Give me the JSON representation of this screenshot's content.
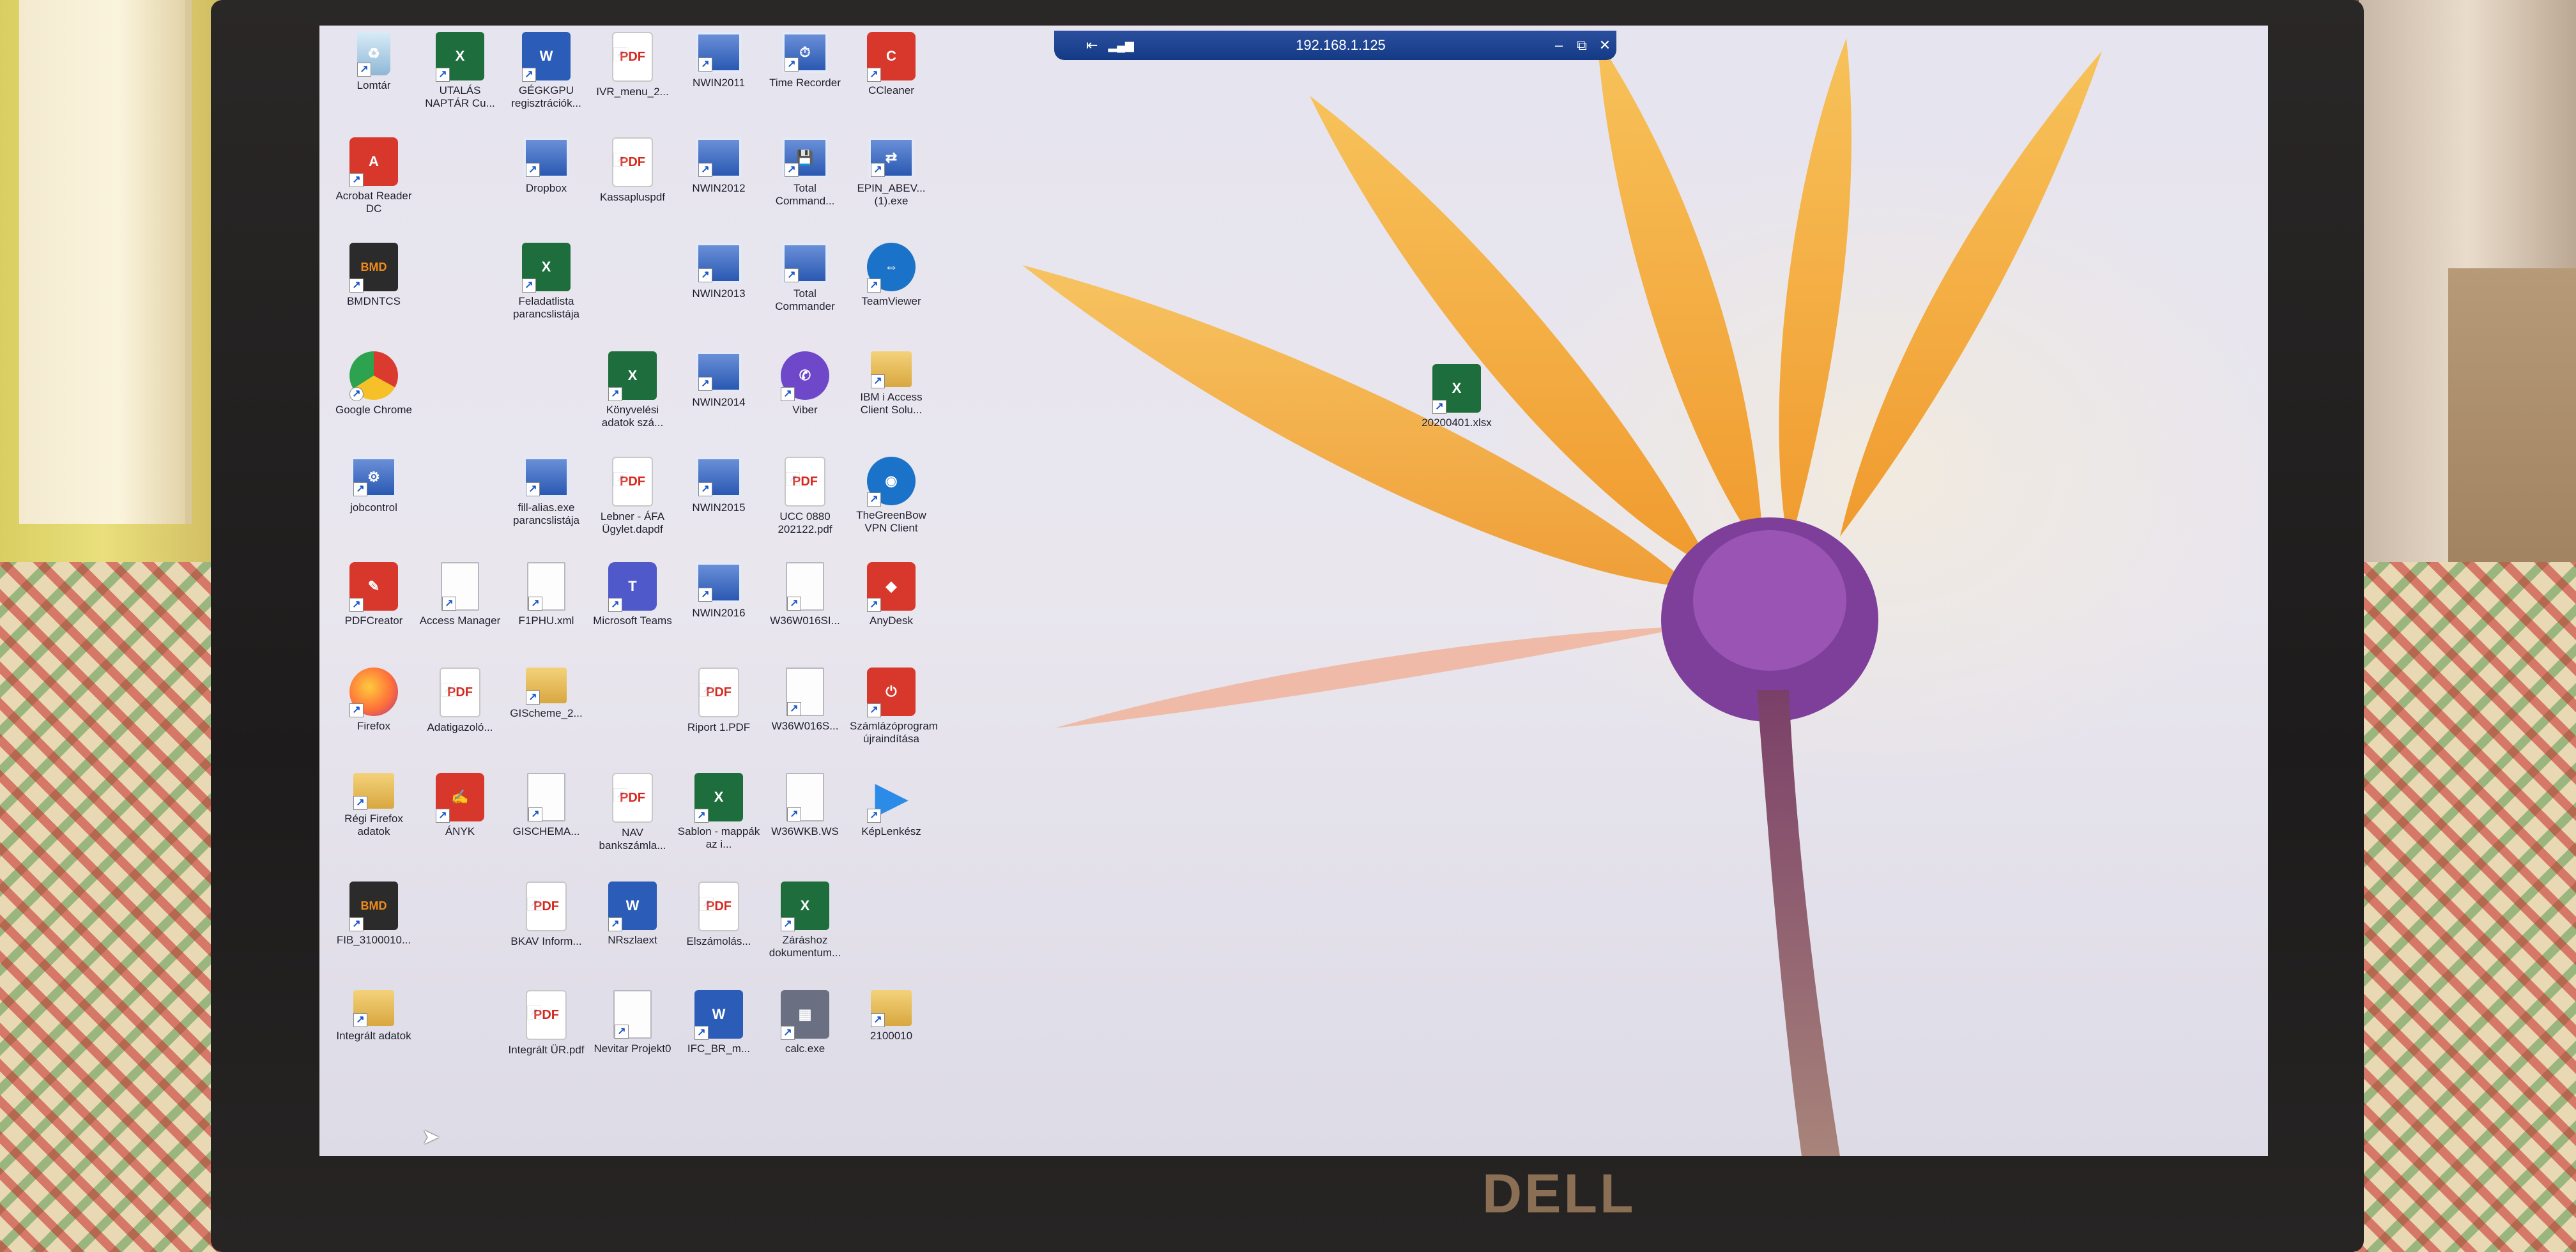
{
  "remote_session": {
    "host": "192.168.1.125",
    "pin_glyph": "⇤",
    "signal_glyph": "▂▄▆",
    "minimize_glyph": "–",
    "restore_glyph": "⧉",
    "close_glyph": "✕"
  },
  "laptop": {
    "brand": "DELL"
  },
  "desktop": {
    "icons": [
      {
        "label": "Lomtár",
        "type": "recycle-bin-icon",
        "glyph": "♻"
      },
      {
        "label": "UTALÁS NAPTÁR Cu...",
        "type": "excel-icon",
        "glyph": "X"
      },
      {
        "label": "GÉGKGPU regisztrációk...",
        "type": "word-icon",
        "glyph": "W"
      },
      {
        "label": "IVR_menu_2...",
        "type": "pdf-icon",
        "glyph": "PDF"
      },
      {
        "label": "NWIN2011",
        "type": "app-icon",
        "glyph": ""
      },
      {
        "label": "Time Recorder",
        "type": "app-icon",
        "glyph": "⏱"
      },
      {
        "label": "CCleaner",
        "type": "ccleaner-icon",
        "glyph": "C"
      },
      {
        "label": "Acrobat Reader DC",
        "type": "acrobat-icon",
        "glyph": "A"
      },
      {
        "label": "Dropbox",
        "type": "app-icon",
        "glyph": ""
      },
      {
        "label": "Kassapluspdf",
        "type": "pdf-icon",
        "glyph": "PDF"
      },
      {
        "label": "NWIN2012",
        "type": "app-icon",
        "glyph": ""
      },
      {
        "label": "Total Command...",
        "type": "floppy-icon",
        "glyph": "💾"
      },
      {
        "label": "EPIN_ABEV... (1).exe",
        "type": "app-icon",
        "glyph": "⇄"
      },
      {
        "label": "BMDNTCS",
        "type": "bmd-icon",
        "glyph": "BMD"
      },
      {
        "label": "Feladatlista parancslistája",
        "type": "excel-icon",
        "glyph": "X"
      },
      {
        "label": "NWIN2013",
        "type": "app-icon",
        "glyph": ""
      },
      {
        "label": "Total Commander",
        "type": "app-icon",
        "glyph": ""
      },
      {
        "label": "TeamViewer",
        "type": "teamviewer-icon",
        "glyph": "⇔"
      },
      {
        "label": "Google Chrome",
        "type": "chrome-icon",
        "glyph": ""
      },
      {
        "label": "Könyvelési adatok szá...",
        "type": "excel-icon",
        "glyph": "X"
      },
      {
        "label": "NWIN2014",
        "type": "app-icon",
        "glyph": ""
      },
      {
        "label": "Viber",
        "type": "viber-icon",
        "glyph": "✆"
      },
      {
        "label": "IBM i Access Client Solu...",
        "type": "folder-icon",
        "glyph": ""
      },
      {
        "label": "jobcontrol",
        "type": "setup-icon",
        "glyph": "⚙"
      },
      {
        "label": "fill-alias.exe parancslistája",
        "type": "app-icon",
        "glyph": ""
      },
      {
        "label": "Lebner - ÁFA Ügylet.dapdf",
        "type": "pdf-icon",
        "glyph": "PDF"
      },
      {
        "label": "NWIN2015",
        "type": "app-icon",
        "glyph": ""
      },
      {
        "label": "UCC 0880 202122.pdf",
        "type": "pdf-icon",
        "glyph": "PDF"
      },
      {
        "label": "TheGreenBow VPN Client",
        "type": "vpn-icon",
        "glyph": "◉"
      },
      {
        "label": "PDFCreator",
        "type": "pdfcreator-icon",
        "glyph": "✎"
      },
      {
        "label": "Access Manager",
        "type": "document-icon",
        "glyph": ""
      },
      {
        "label": "F1PHU.xml",
        "type": "document-icon",
        "glyph": ""
      },
      {
        "label": "Microsoft Teams",
        "type": "teams-icon",
        "glyph": "T"
      },
      {
        "label": "NWIN2016",
        "type": "app-icon",
        "glyph": ""
      },
      {
        "label": "W36W016SI...",
        "type": "document-icon",
        "glyph": ""
      },
      {
        "label": "AnyDesk",
        "type": "anydesk-icon",
        "glyph": "◆"
      },
      {
        "label": "Firefox",
        "type": "firefox-icon",
        "glyph": ""
      },
      {
        "label": "Adatigazoló...",
        "type": "pdf-icon",
        "glyph": "PDF"
      },
      {
        "label": "GIScheme_2...",
        "type": "archive-icon",
        "glyph": ""
      },
      {
        "label": "Riport 1.PDF",
        "type": "pdf-icon",
        "glyph": "PDF"
      },
      {
        "label": "W36W016S...",
        "type": "document-icon",
        "glyph": ""
      },
      {
        "label": "Számlázóprogram újraindítása",
        "type": "power-icon",
        "glyph": "⏻"
      },
      {
        "label": "Régi Firefox adatok",
        "type": "folder-icon",
        "glyph": ""
      },
      {
        "label": "ÁNYK",
        "type": "anyk-icon",
        "glyph": "✍"
      },
      {
        "label": "GISCHEMA...",
        "type": "document-icon",
        "glyph": ""
      },
      {
        "label": "NAV bankszámla...",
        "type": "pdf-icon",
        "glyph": "PDF"
      },
      {
        "label": "Sablon - mappák az i...",
        "type": "excel-icon",
        "glyph": "X"
      },
      {
        "label": "W36WKB.WS",
        "type": "document-icon",
        "glyph": ""
      },
      {
        "label": "KépLenkész",
        "type": "arrow-icon",
        "glyph": "▶"
      },
      {
        "label": "FIB_3100010...",
        "type": "bmd-icon",
        "glyph": "BMD"
      },
      {
        "label": "BKAV Inform...",
        "type": "pdf-icon",
        "glyph": "PDF"
      },
      {
        "label": "NRszlaext",
        "type": "word-icon",
        "glyph": "W"
      },
      {
        "label": "Elszámolás...",
        "type": "pdf-icon",
        "glyph": "PDF"
      },
      {
        "label": "Záráshoz dokumentum...",
        "type": "excel-icon",
        "glyph": "X"
      },
      {
        "label": "Integrált adatok",
        "type": "folder-icon",
        "glyph": ""
      },
      {
        "label": "Integrált ÜR.pdf",
        "type": "pdf-icon",
        "glyph": "PDF"
      },
      {
        "label": "Nevitar Projekt0",
        "type": "document-icon",
        "glyph": ""
      },
      {
        "label": "IFC_BR_m...",
        "type": "word-icon",
        "glyph": "W"
      },
      {
        "label": "calc.exe",
        "type": "calculator-icon",
        "glyph": "▦"
      },
      {
        "label": "2100010",
        "type": "folder-icon",
        "glyph": ""
      },
      {
        "label": "20200401.xlsx",
        "type": "excel-icon",
        "glyph": "X"
      }
    ]
  }
}
